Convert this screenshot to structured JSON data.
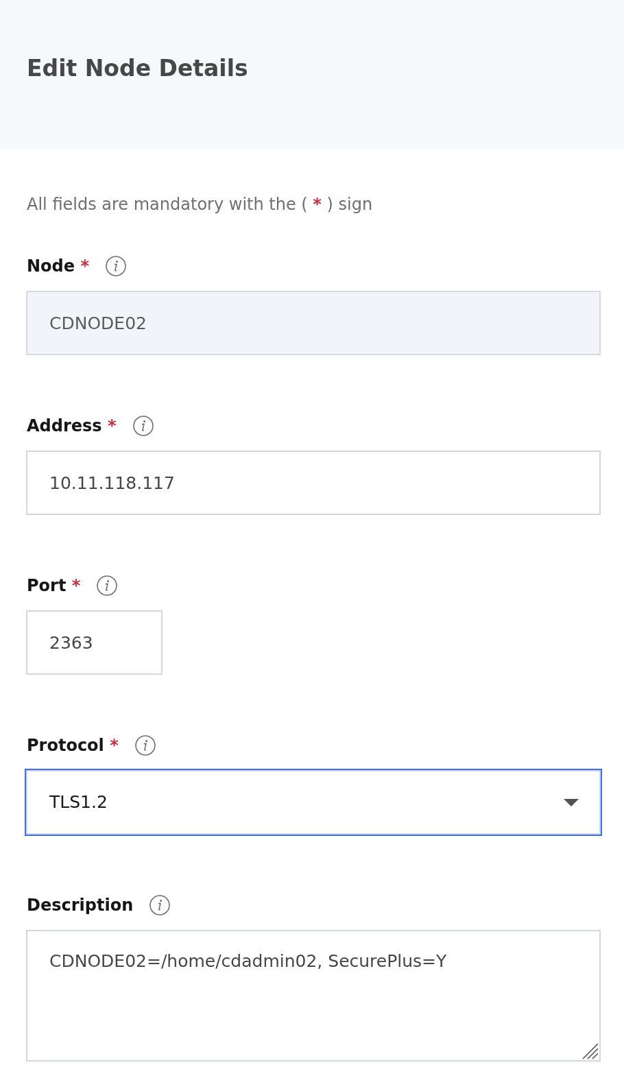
{
  "header": {
    "title": "Edit Node Details"
  },
  "intro": {
    "text_before": "All fields are mandatory with the ( ",
    "required_mark": "*",
    "text_after": " ) sign"
  },
  "fields": [
    {
      "kind": "text",
      "label": "Node",
      "required_mark": "*",
      "value": "CDNODE02",
      "disabled": true,
      "focused": false
    },
    {
      "kind": "text",
      "label": "Address",
      "required_mark": "*",
      "value": "10.11.118.117",
      "disabled": false,
      "focused": false
    },
    {
      "kind": "number",
      "label": "Port",
      "required_mark": "*",
      "value": "2363",
      "disabled": false,
      "focused": false
    },
    {
      "kind": "select",
      "label": "Protocol",
      "required_mark": "*",
      "value": "TLS1.2",
      "disabled": false,
      "focused": true
    },
    {
      "kind": "textarea",
      "label": "Description",
      "value": "CDNODE02=/home/cdadmin02, SecurePlus=Y",
      "disabled": false,
      "focused": false
    }
  ]
}
